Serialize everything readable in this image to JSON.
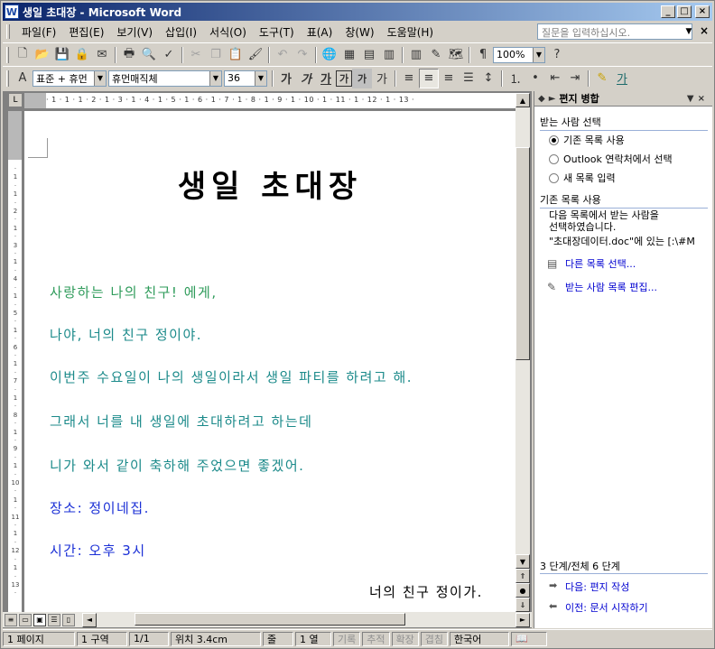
{
  "window": {
    "title": "생일 초대장 - Microsoft Word",
    "app_icon": "W"
  },
  "menu": {
    "items": [
      "파일(F)",
      "편집(E)",
      "보기(V)",
      "삽입(I)",
      "서식(O)",
      "도구(T)",
      "표(A)",
      "창(W)",
      "도움말(H)"
    ],
    "ask_placeholder": "질문을 입력하십시오."
  },
  "toolbar": {
    "zoom": "100%",
    "style": "표준 + 휴먼",
    "font": "휴먼매직체",
    "size": "36",
    "bold": "가",
    "italic": "가",
    "underline": "가",
    "charborder": "가",
    "charshade": "가"
  },
  "ruler": {
    "h_ticks": "· 1 · 1 · 1 · 2 · 1 · 3 · 1 · 4 · 1 · 5 · 1 · 6 · 1 · 7 · 1 · 8 · 1 · 9 · 1 · 10 · 1 · 11 · 1 · 12 · 1 · 13 ·"
  },
  "document": {
    "title": "생일 초대장",
    "lines": [
      {
        "text": "사랑하는 나의 친구! 에게,",
        "color": "#2e9b5a"
      },
      {
        "text": "나야, 너의 친구 정이야.",
        "color": "#1b8a8a"
      },
      {
        "text": "이번주 수요일이 나의 생일이라서 생일 파티를 하려고 해.",
        "color": "#1b8a8a"
      },
      {
        "text": "그래서 너를 내 생일에 초대하려고 하는데",
        "color": "#1b8a8a"
      },
      {
        "text": "니가 와서 같이 축하해 주었으면 좋겠어.",
        "color": "#1b8a8a"
      },
      {
        "text": "장소: 정이네집.",
        "color": "#1a2fd6"
      },
      {
        "text": "시간: 오후 3시",
        "color": "#1a2fd6"
      }
    ],
    "signature": "너의 친구 정이가."
  },
  "task_pane": {
    "title": "편지 병합",
    "section_recipients": "받는 사람 선택",
    "options": [
      "기존 목록 사용",
      "Outlook 연락처에서 선택",
      "새 목록 입력"
    ],
    "selected_option": 0,
    "section_existing": "기존 목록 사용",
    "desc_line1": "다음 목록에서 받는 사람을",
    "desc_line2": "선택하였습니다.",
    "file_line": "\"초대장데이터.doc\"에 있는 [:\\#M",
    "link_other": "다른 목록 선택...",
    "link_edit": "받는 사람 목록 편집...",
    "step": "3 단계/전체  6 단계",
    "next": "다음: 편지 작성",
    "prev": "이전: 문서 시작하기"
  },
  "status": {
    "page": "1 페이지",
    "section": "1 구역",
    "pages": "1/1",
    "position": "위치 3.4cm",
    "line": "줄",
    "col": "1 열",
    "rec": "기록",
    "trk": "추적",
    "ext": "확장",
    "ovr": "겹침",
    "lang": "한국어"
  }
}
